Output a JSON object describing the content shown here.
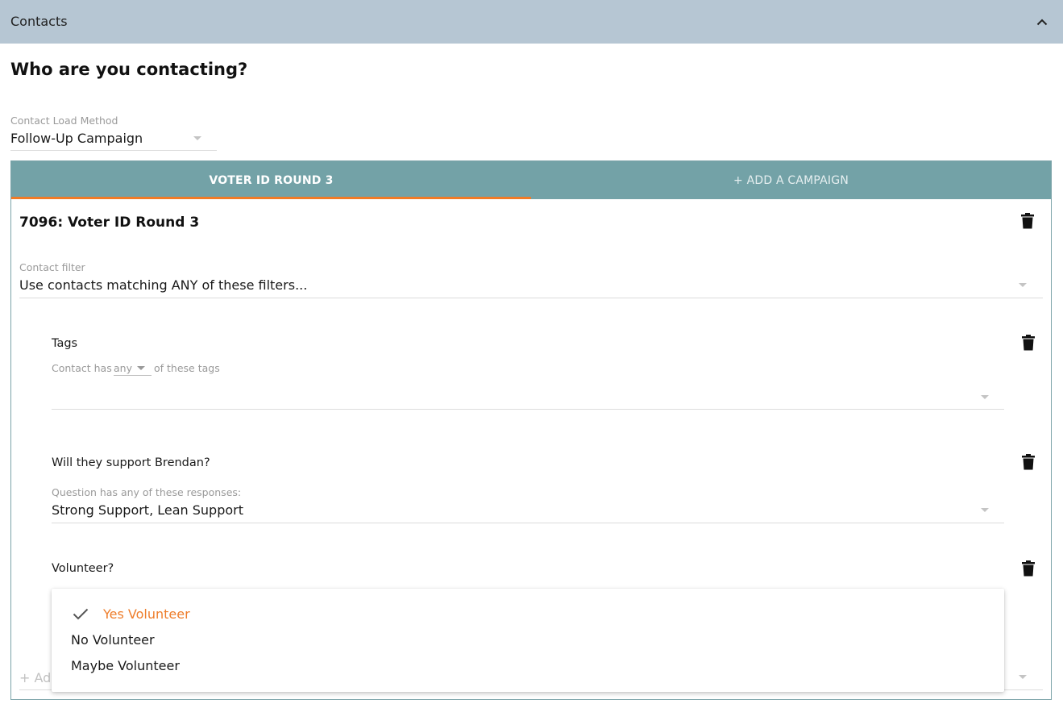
{
  "header": {
    "title": "Contacts",
    "collapse_icon": "chevron-up-icon"
  },
  "section": {
    "heading": "Who are you contacting?"
  },
  "load_method": {
    "label": "Contact Load Method",
    "value": "Follow-Up Campaign"
  },
  "tabs": [
    {
      "label": "VOTER ID ROUND 3",
      "active": true
    },
    {
      "label": "+ ADD A CAMPAIGN",
      "active": false
    }
  ],
  "campaign": {
    "title": "7096: Voter ID Round 3",
    "contact_filter": {
      "label": "Contact filter",
      "value": "Use contacts matching ANY of these filters..."
    },
    "filters": [
      {
        "title": "Tags",
        "prefix": "Contact has",
        "mode": "any",
        "suffix": "of these tags",
        "value": ""
      },
      {
        "title": "Will they support Brendan?",
        "label": "Question has any of these responses:",
        "value": "Strong Support, Lean Support"
      },
      {
        "title": "Volunteer?"
      }
    ],
    "add_filter_label": "+ Add"
  },
  "dropdown": {
    "options": [
      {
        "label": "Yes Volunteer",
        "selected": true
      },
      {
        "label": "No Volunteer",
        "selected": false
      },
      {
        "label": "Maybe Volunteer",
        "selected": false
      }
    ]
  },
  "colors": {
    "header_bg": "#b6c6d3",
    "tab_bg": "#73a2a7",
    "accent": "#f07b26",
    "selected_text": "#ee7d2b"
  }
}
